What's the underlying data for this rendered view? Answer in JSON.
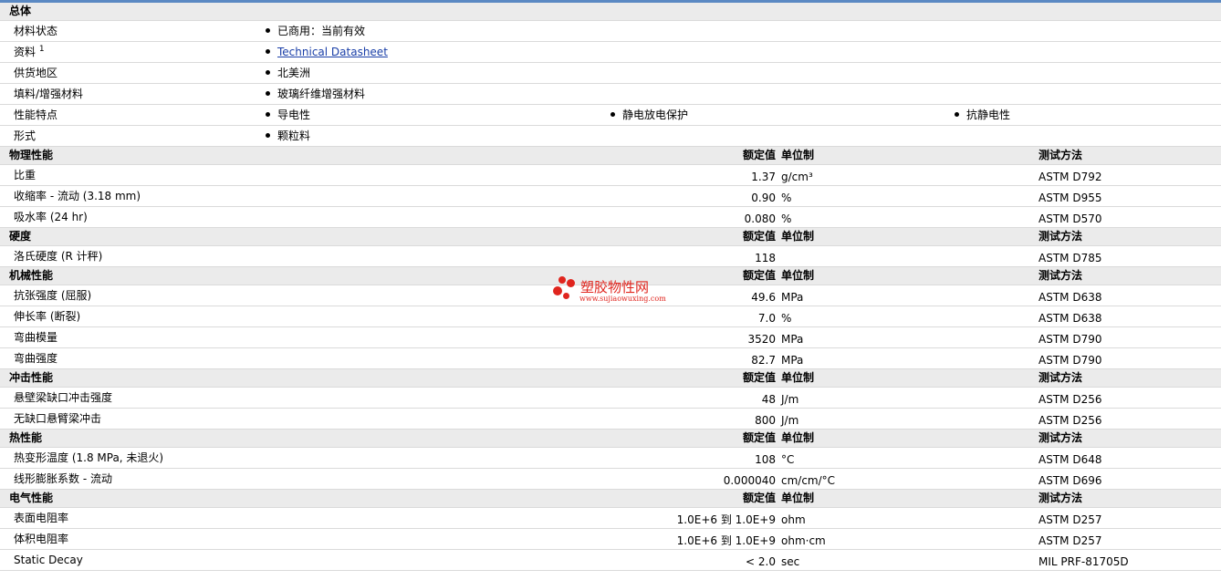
{
  "general": {
    "title": "总体",
    "rows": [
      {
        "label": "材料状态",
        "values": [
          "已商用：当前有效"
        ]
      },
      {
        "label": "资料",
        "sup": "1",
        "values": [
          "Technical Datasheet"
        ],
        "link": true
      },
      {
        "label": "供货地区",
        "values": [
          "北美洲"
        ]
      },
      {
        "label": "填料/增强材料",
        "values": [
          "玻璃纤维增强材料"
        ]
      },
      {
        "label": "性能特点",
        "values": [
          "导电性",
          "静电放电保护",
          "抗静电性"
        ]
      },
      {
        "label": "形式",
        "values": [
          "颗粒料"
        ]
      }
    ]
  },
  "headers": {
    "value": "额定值",
    "unit": "单位制",
    "method": "测试方法"
  },
  "sections": [
    {
      "title": "物理性能",
      "rows": [
        {
          "label": "比重",
          "value": "1.37",
          "unit": "g/cm³",
          "method": "ASTM D792"
        },
        {
          "label": "收缩率  - 流动 (3.18 mm)",
          "value": "0.90",
          "unit": "%",
          "method": "ASTM D955"
        },
        {
          "label": "吸水率 (24 hr)",
          "value": "0.080",
          "unit": "%",
          "method": "ASTM D570"
        }
      ]
    },
    {
      "title": "硬度",
      "rows": [
        {
          "label": "洛氏硬度 (R 计秤)",
          "value": "118",
          "unit": "",
          "method": "ASTM D785"
        }
      ]
    },
    {
      "title": "机械性能",
      "rows": [
        {
          "label": "抗张强度 (屈服)",
          "value": "49.6",
          "unit": "MPa",
          "method": "ASTM D638"
        },
        {
          "label": "伸长率 (断裂)",
          "value": "7.0",
          "unit": "%",
          "method": "ASTM D638"
        },
        {
          "label": "弯曲模量",
          "value": "3520",
          "unit": "MPa",
          "method": "ASTM D790"
        },
        {
          "label": "弯曲强度",
          "value": "82.7",
          "unit": "MPa",
          "method": "ASTM D790"
        }
      ]
    },
    {
      "title": "冲击性能",
      "rows": [
        {
          "label": "悬壁梁缺口冲击强度",
          "value": "48",
          "unit": "J/m",
          "method": "ASTM D256"
        },
        {
          "label": "无缺口悬臂梁冲击",
          "value": "800",
          "unit": "J/m",
          "method": "ASTM D256"
        }
      ]
    },
    {
      "title": "热性能",
      "rows": [
        {
          "label": "热变形温度 (1.8 MPa, 未退火)",
          "value": "108",
          "unit": "°C",
          "method": "ASTM D648"
        },
        {
          "label": "线形膨胀系数  - 流动",
          "value": "0.000040",
          "unit": "cm/cm/°C",
          "method": "ASTM D696"
        }
      ]
    },
    {
      "title": "电气性能",
      "rows": [
        {
          "label": "表面电阻率",
          "value": "1.0E+6 到  1.0E+9",
          "unit": "ohm",
          "method": "ASTM D257"
        },
        {
          "label": "体积电阻率",
          "value": "1.0E+6 到  1.0E+9",
          "unit": "ohm·cm",
          "method": "ASTM D257"
        },
        {
          "label": "Static Decay",
          "value": "< 2.0",
          "unit": "sec",
          "method": "MIL PRF-81705D"
        }
      ]
    }
  ],
  "watermark": {
    "title": "塑胶物性网",
    "url": "www.sujiaowuxing.com"
  }
}
